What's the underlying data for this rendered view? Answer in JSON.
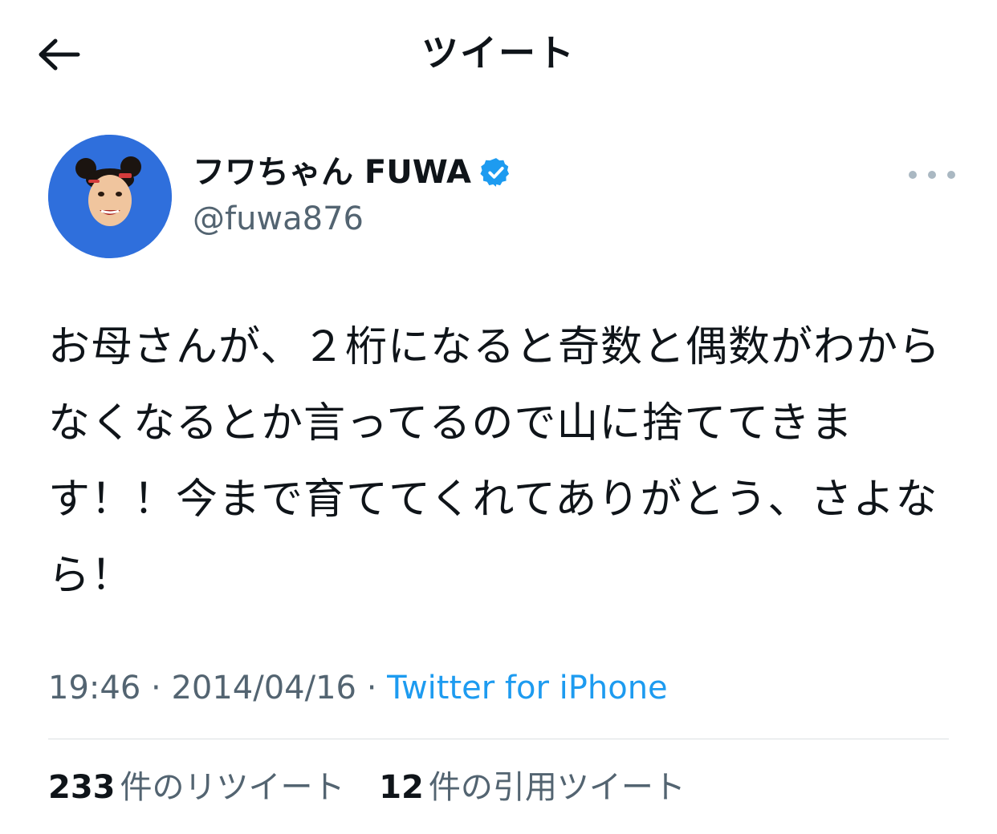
{
  "header": {
    "title": "ツイート",
    "back_icon": "back-arrow-icon"
  },
  "author": {
    "display_name": "フワちゃん FUWA",
    "handle": "@fuwa876",
    "verified": true,
    "avatar_bg": "#2f6fdc"
  },
  "tweet": {
    "text": "お母さんが、２桁になると奇数と偶数がわからなくなるとか言ってるので山に捨ててきます！！今まで育ててくれてありがとう、さよなら！",
    "time": "19:46",
    "separator": "·",
    "date": "2014/04/16",
    "source": "Twitter for iPhone"
  },
  "stats": {
    "retweets": {
      "count": "233",
      "label": "件のリツイート"
    },
    "quotes": {
      "count": "12",
      "label": "件の引用ツイート"
    }
  },
  "colors": {
    "text": "#0f1419",
    "secondary": "#536471",
    "link": "#1d9bf0",
    "verified_badge": "#1d9bf0"
  }
}
